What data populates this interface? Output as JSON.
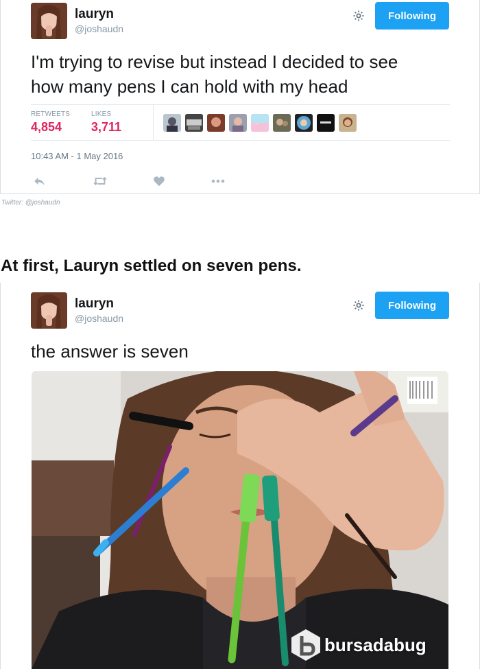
{
  "tweet1": {
    "name": "lauryn",
    "handle": "@joshaudn",
    "follow_label": "Following",
    "text_line1": "I'm trying to revise but instead I decided to see",
    "text_line2": "how many pens I can hold with my head",
    "retweets_label": "RETWEETS",
    "retweets_value": "4,854",
    "likes_label": "LIKES",
    "likes_value": "3,711",
    "timestamp": "10:43 AM - 1 May 2016"
  },
  "source_credit": "Twitter: @joshaudn",
  "section_heading": "At first, Lauryn settled on seven pens.",
  "tweet2": {
    "name": "lauryn",
    "handle": "@joshaudn",
    "follow_label": "Following",
    "text": "the answer is seven"
  },
  "watermark": "bursadabug",
  "colors": {
    "follow_button": "#1da1f2",
    "stat_value": "#e0245e",
    "muted_text": "#8899a6",
    "border": "#e1e8ed"
  },
  "icons": [
    "gear-icon",
    "reply-icon",
    "retweet-icon",
    "like-icon",
    "more-icon"
  ]
}
